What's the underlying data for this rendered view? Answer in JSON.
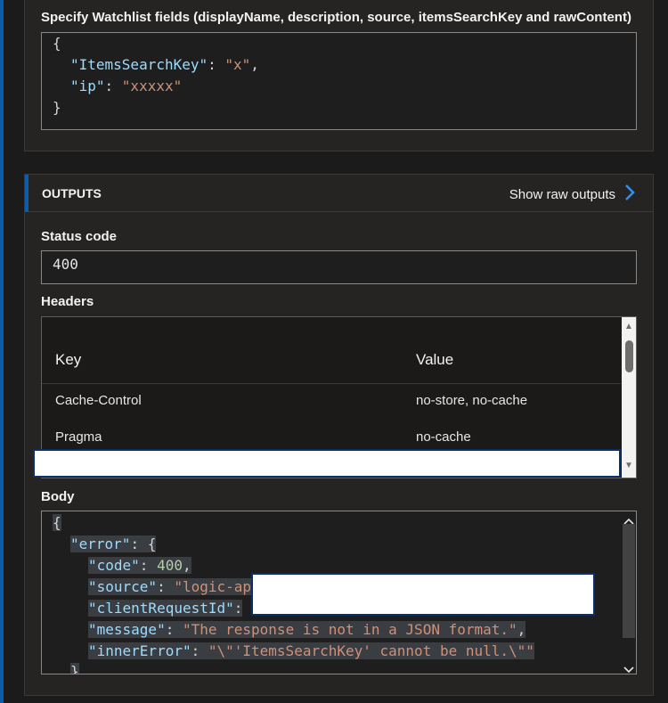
{
  "inputs": {
    "fields_label": "Specify Watchlist fields (displayName, description, source, itemsSearchKey and rawContent)",
    "fields_json": {
      "open": "{",
      "line1_key": "\"ItemsSearchKey\"",
      "line1_sep": ": ",
      "line1_val": "\"x\"",
      "line1_end": ",",
      "line2_key": "\"ip\"",
      "line2_sep": ": ",
      "line2_val": "\"xxxxx\"",
      "close": "}"
    }
  },
  "outputs": {
    "title": "OUTPUTS",
    "show_raw_label": "Show raw outputs",
    "status_label": "Status code",
    "status_value": "400",
    "headers_label": "Headers",
    "headers_table": {
      "columns": [
        "Key",
        "Value"
      ],
      "rows": [
        {
          "key": "Cache-Control",
          "value": "no-store, no-cache"
        },
        {
          "key": "Pragma",
          "value": "no-cache"
        }
      ]
    },
    "body_label": "Body",
    "body_json": {
      "l0": "{",
      "l1_key": "\"error\"",
      "l1_rest": ": {",
      "l2_key": "\"code\"",
      "l2_sep": ": ",
      "l2_val": "400",
      "l2_end": ",",
      "l3_key": "\"source\"",
      "l3_sep": ": ",
      "l3_val": "\"logic-ap",
      "l4_key": "\"clientRequestId\"",
      "l4_sep": ":",
      "l5_key": "\"message\"",
      "l5_sep": ": ",
      "l5_val": "\"The response is not in a JSON format.\"",
      "l5_end": ",",
      "l6_key": "\"innerError\"",
      "l6_sep": ": ",
      "l6_val": "\"\\\"'ItemsSearchKey' cannot be null.\\\"\"",
      "l7": "}"
    }
  },
  "colors": {
    "accent": "#0b5cab",
    "json_key": "#9cdcfe",
    "json_string": "#ce9178",
    "json_number": "#b5cea8"
  }
}
